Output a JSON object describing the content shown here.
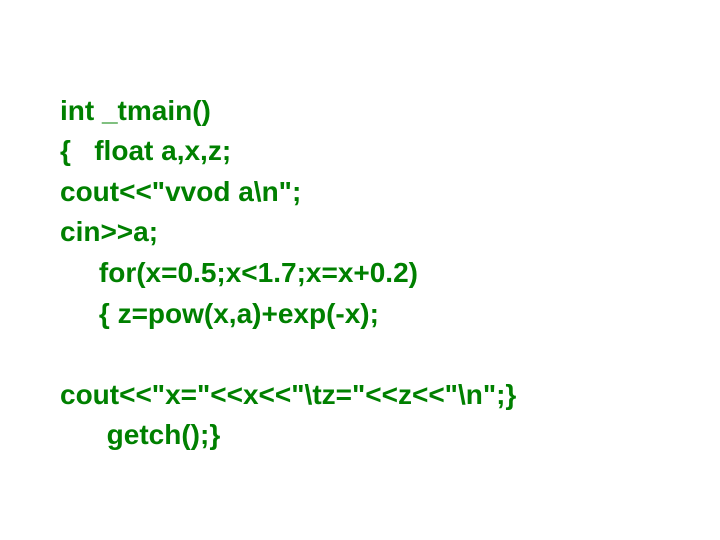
{
  "code": {
    "color": "#008000",
    "lines": [
      "int _tmain()",
      "{   float a,x,z;",
      "cout<<\"vvod a\\n\";",
      "cin>>a;",
      "     for(x=0.5;x<1.7;x=x+0.2)",
      "     { z=pow(x,a)+exp(-x);",
      "",
      "cout<<\"x=\"<<x<<\"\\tz=\"<<z<<\"\\n\";}",
      "      getch();}"
    ]
  }
}
